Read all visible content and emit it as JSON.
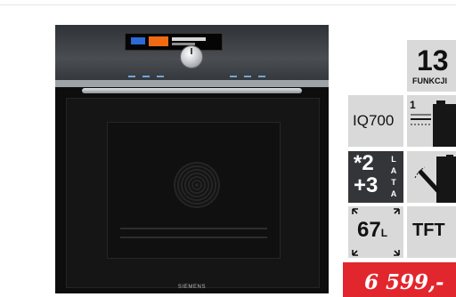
{
  "product": {
    "brand": "SIEMENS"
  },
  "badges": {
    "functions_count": "13",
    "functions_label": "FUNKCJI",
    "series": "IQ700",
    "heating_level": "1",
    "warranty_base": "*2",
    "warranty_extra": "+3",
    "warranty_unit_letters": [
      "L",
      "A",
      "T",
      "A"
    ],
    "capacity_value": "67",
    "capacity_unit": "L",
    "display_type": "TFT"
  },
  "price": {
    "value": "6 599,-"
  },
  "colors": {
    "price_bg": "#e2262d",
    "tile_bg": "#d9d9d9",
    "warranty_bg": "#333538",
    "oven_body": "#0d0d0d"
  },
  "icons": {
    "heating": "heating-elements-icon",
    "door": "soft-close-door-icon",
    "capacity": "capacity-arrows-icon"
  }
}
